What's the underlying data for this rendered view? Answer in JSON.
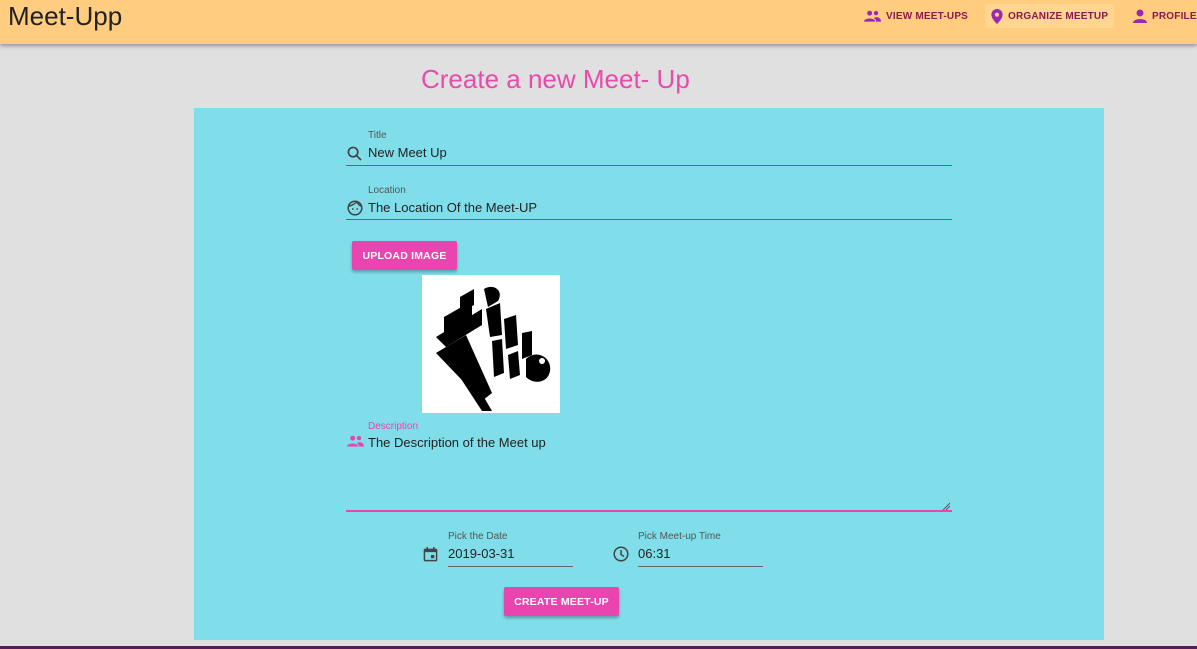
{
  "app": {
    "title": "Meet-Upp"
  },
  "nav": {
    "view_meetups": "VIEW MEET-UPS",
    "organize_meetup": "ORGANIZE MEETUP",
    "profile": "PROFILE"
  },
  "page": {
    "title": "Create a new Meet- Up"
  },
  "form": {
    "title": {
      "label": "Title",
      "value": "New Meet Up"
    },
    "location": {
      "label": "Location",
      "value": "The Location Of the Meet-UP"
    },
    "upload_label": "UPLOAD IMAGE",
    "description": {
      "label": "Description",
      "value": "The Description of the Meet up"
    },
    "date": {
      "label": "Pick the Date",
      "value": "2019-03-31"
    },
    "time": {
      "label": "Pick Meet-up Time",
      "value": "06:31"
    },
    "submit_label": "CREATE MEET-UP"
  },
  "colors": {
    "toolbar": "#ffcc80",
    "card": "#80deea",
    "accent": "#e944b0",
    "nav_icon": "#9c27b0"
  },
  "icons": [
    "people-icon",
    "location-pin-icon",
    "person-icon",
    "search-icon",
    "face-icon",
    "calendar-icon",
    "clock-icon"
  ]
}
